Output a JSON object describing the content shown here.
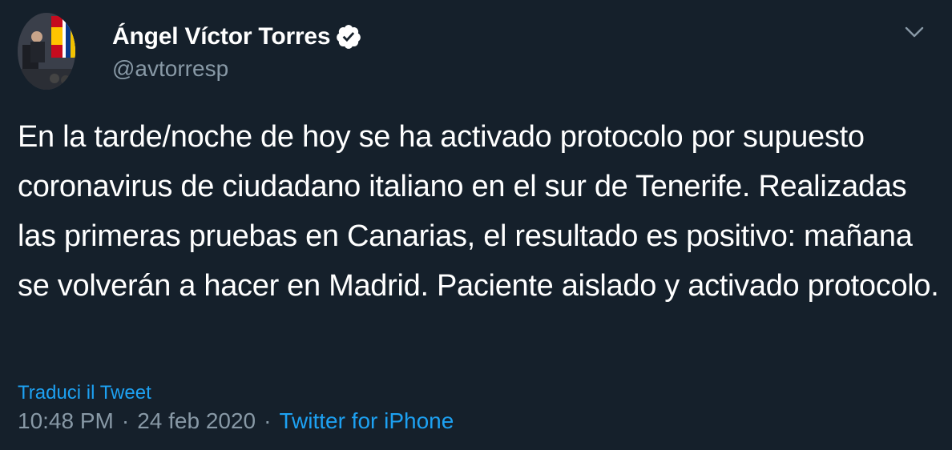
{
  "author": {
    "display_name": "Ángel Víctor Torres",
    "handle": "@avtorresp",
    "verified": true
  },
  "tweet": {
    "text": "En la tarde/noche de hoy se ha activado protocolo por supuesto coronavirus de ciudadano italiano en el sur de Tenerife. Realizadas las primeras pruebas en Canarias, el resultado es positivo: mañana se volverán a hacer en Madrid. Paciente aislado y activado protocolo.",
    "translate_label": "Traduci il Tweet",
    "time": "10:48 PM",
    "separator": "·",
    "date": "24 feb 2020",
    "source": "Twitter for iPhone"
  },
  "icons": {
    "verified": "verified-badge-icon",
    "more": "chevron-down-icon"
  },
  "colors": {
    "background": "#15202b",
    "primary_text": "#ffffff",
    "secondary_text": "#8899a6",
    "link": "#1da1f2"
  }
}
